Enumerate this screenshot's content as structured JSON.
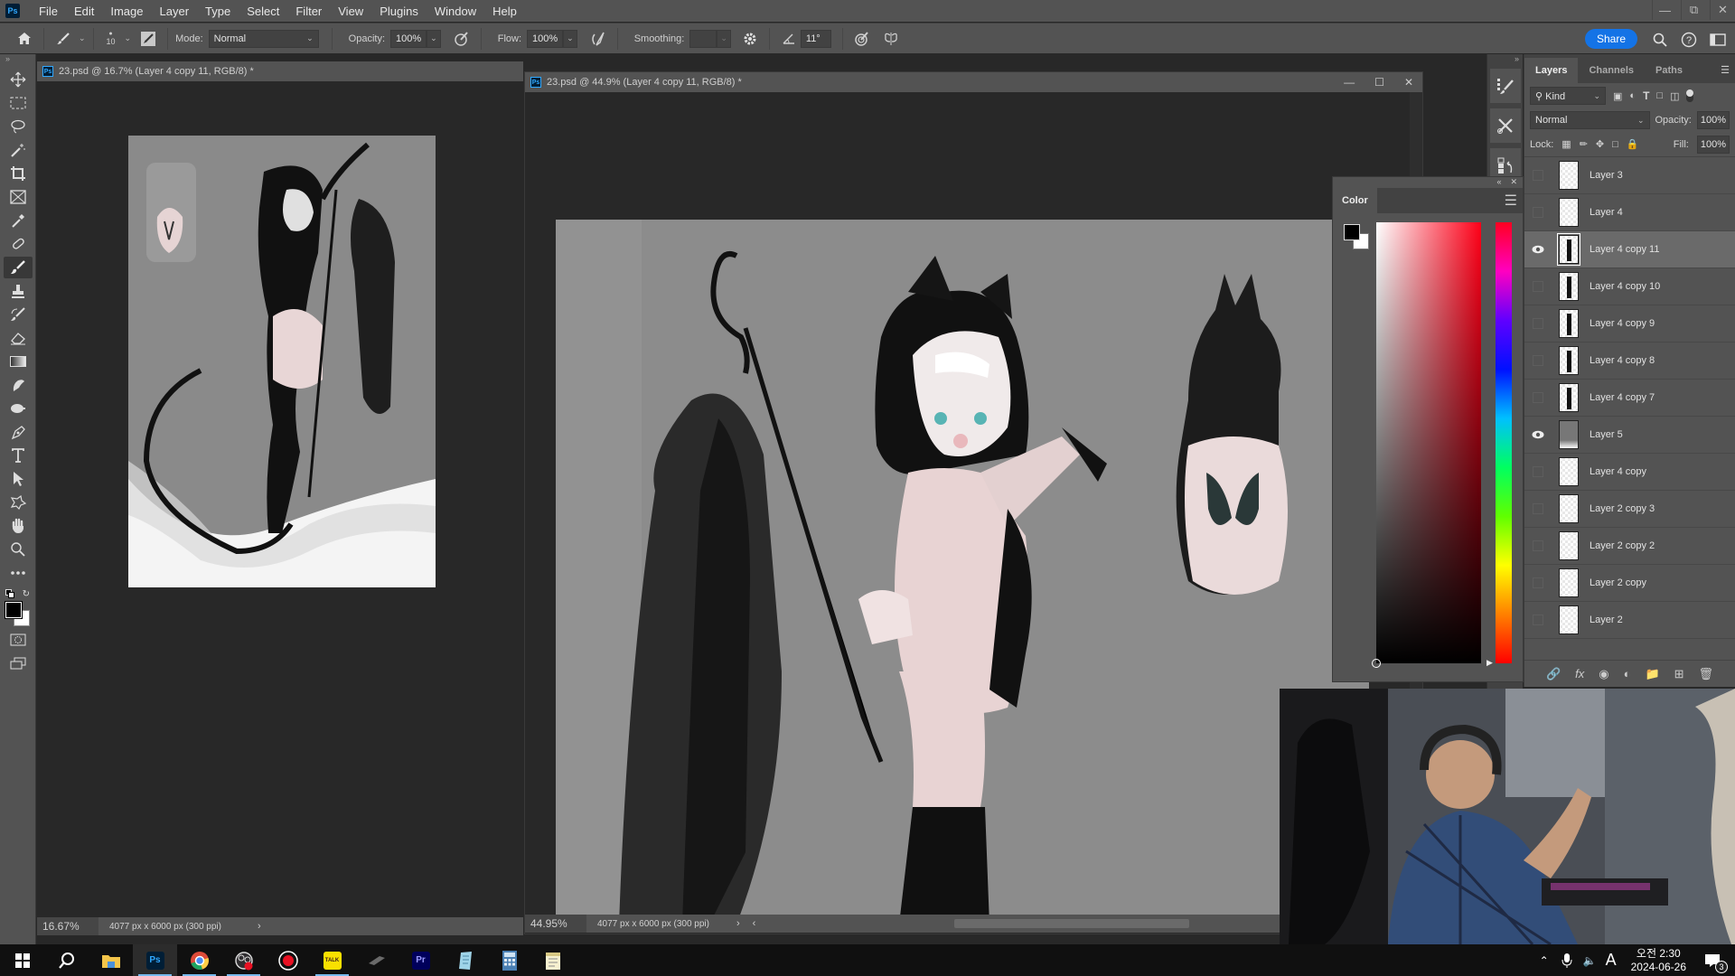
{
  "app": {
    "menu": [
      "File",
      "Edit",
      "Image",
      "Layer",
      "Type",
      "Select",
      "Filter",
      "View",
      "Plugins",
      "Window",
      "Help"
    ],
    "window_controls": [
      "minimize",
      "restore",
      "close"
    ]
  },
  "options_bar": {
    "brush_size": "10",
    "mode_label": "Mode:",
    "mode_value": "Normal",
    "opacity_label": "Opacity:",
    "opacity_value": "100%",
    "flow_label": "Flow:",
    "flow_value": "100%",
    "smoothing_label": "Smoothing:",
    "smoothing_value": "",
    "angle_value": "11°",
    "share_label": "Share"
  },
  "tools": [
    "move",
    "marquee",
    "lasso",
    "magic-wand",
    "crop",
    "frame",
    "eyedropper",
    "healing-brush",
    "brush",
    "clone-stamp",
    "history-brush",
    "eraser",
    "gradient",
    "smudge",
    "dodge",
    "pen",
    "type",
    "path-selection",
    "shape",
    "hand",
    "zoom",
    "more"
  ],
  "active_tool": "brush",
  "documents": [
    {
      "title": "23.psd @ 16.7% (Layer 4 copy 11, RGB/8) *",
      "zoom": "16.67%",
      "info": "4077 px x 6000 px (300 ppi)"
    },
    {
      "title": "23.psd @ 44.9% (Layer 4 copy 11, RGB/8) *",
      "zoom": "44.95%",
      "info": "4077 px x 6000 px (300 ppi)"
    }
  ],
  "layers_panel": {
    "tabs": [
      "Layers",
      "Channels",
      "Paths"
    ],
    "active_tab": "Layers",
    "filter_label": "Kind",
    "blend_mode": "Normal",
    "opacity_label": "Opacity:",
    "opacity_value": "100%",
    "lock_label": "Lock:",
    "fill_label": "Fill:",
    "fill_value": "100%",
    "layers": [
      {
        "name": "Layer 3",
        "visible": false,
        "selected": false
      },
      {
        "name": "Layer 4",
        "visible": false,
        "selected": false
      },
      {
        "name": "Layer 4 copy 11",
        "visible": true,
        "selected": true
      },
      {
        "name": "Layer 4 copy 10",
        "visible": false,
        "selected": false
      },
      {
        "name": "Layer 4 copy 9",
        "visible": false,
        "selected": false
      },
      {
        "name": "Layer 4 copy 8",
        "visible": false,
        "selected": false
      },
      {
        "name": "Layer 4 copy 7",
        "visible": false,
        "selected": false
      },
      {
        "name": "Layer 5",
        "visible": true,
        "selected": false
      },
      {
        "name": "Layer 4 copy",
        "visible": false,
        "selected": false
      },
      {
        "name": "Layer 2 copy 3",
        "visible": false,
        "selected": false
      },
      {
        "name": "Layer 2 copy 2",
        "visible": false,
        "selected": false
      },
      {
        "name": "Layer 2 copy",
        "visible": false,
        "selected": false
      },
      {
        "name": "Layer 2",
        "visible": false,
        "selected": false
      }
    ]
  },
  "color_panel": {
    "title": "Color",
    "foreground": "#000000",
    "background": "#ffffff",
    "hue": "#ff0018"
  },
  "taskbar": {
    "apps": [
      "start",
      "search",
      "file-explorer",
      "photoshop",
      "chrome",
      "obs",
      "recorder",
      "kakaotalk",
      "pen-tablet",
      "premiere",
      "notepad-app",
      "calculator",
      "notes"
    ],
    "time": "오전 2:30",
    "date": "2024-06-26",
    "ime": "A",
    "notifications": "3"
  }
}
